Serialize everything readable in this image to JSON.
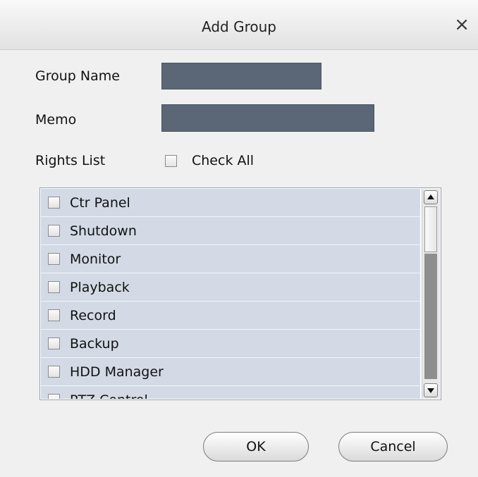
{
  "dialog": {
    "title": "Add Group",
    "close_glyph": "×"
  },
  "form": {
    "group_name_label": "Group Name",
    "group_name_value": "",
    "memo_label": "Memo",
    "memo_value": "",
    "rights_list_label": "Rights List",
    "check_all_label": "Check All",
    "check_all_checked": false
  },
  "rights": {
    "items": [
      {
        "label": "Ctr Panel",
        "checked": false
      },
      {
        "label": "Shutdown",
        "checked": false
      },
      {
        "label": "Monitor",
        "checked": false
      },
      {
        "label": "Playback",
        "checked": false
      },
      {
        "label": "Record",
        "checked": false
      },
      {
        "label": "Backup",
        "checked": false
      },
      {
        "label": "HDD Manager",
        "checked": false
      },
      {
        "label": "PTZ Control",
        "checked": false
      }
    ]
  },
  "buttons": {
    "ok": "OK",
    "cancel": "Cancel"
  },
  "colors": {
    "field_bg": "#5b6676",
    "list_row_bg": "#d3dae6",
    "scroll_track_dark": "#8e8e8e"
  }
}
